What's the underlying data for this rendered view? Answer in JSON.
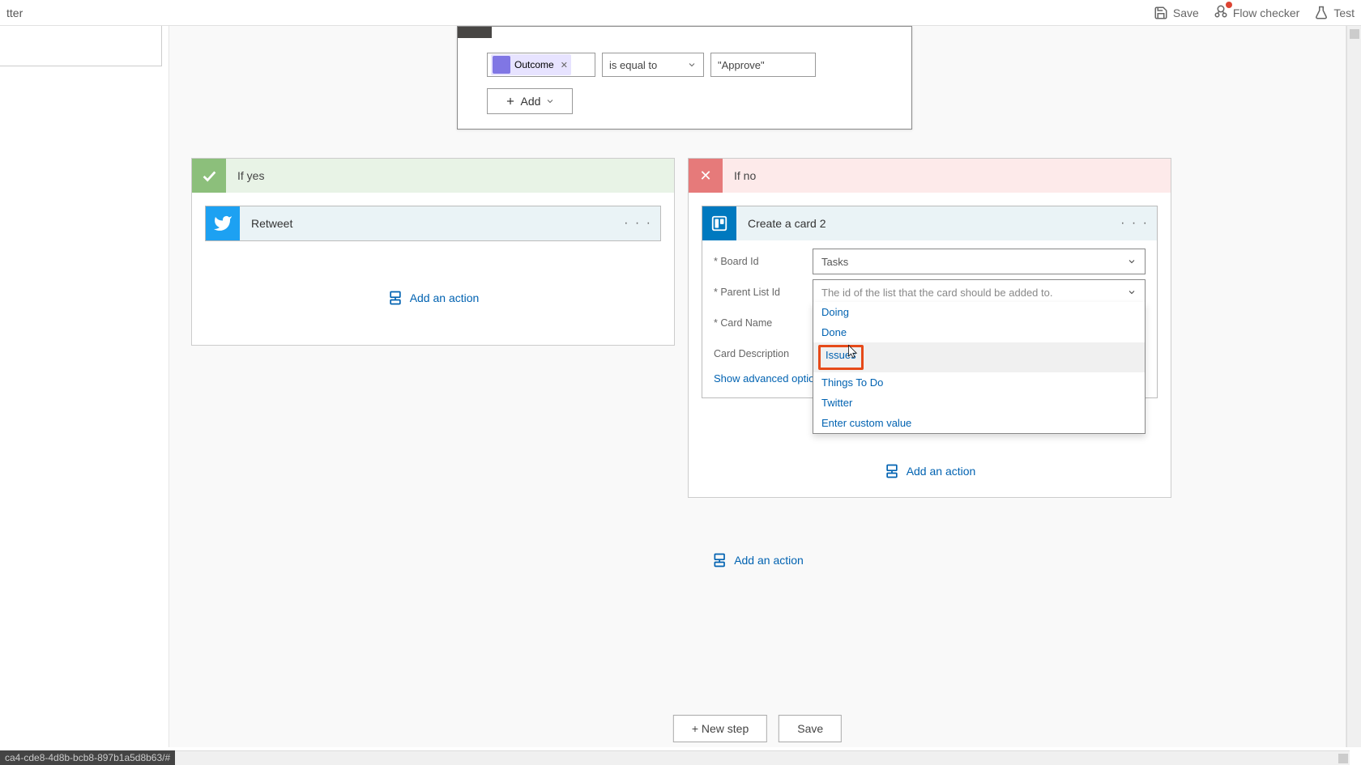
{
  "topbar": {
    "title_fragment": "tter",
    "save": "Save",
    "flow_checker": "Flow checker",
    "test": "Test"
  },
  "condition": {
    "token_label": "Outcome",
    "operator": "is equal to",
    "value": "\"Approve\"",
    "add_label": "Add"
  },
  "branches": {
    "yes_label": "If yes",
    "no_label": "If no"
  },
  "retweet": {
    "title": "Retweet"
  },
  "add_action_label": "Add an action",
  "trello": {
    "title": "Create a card 2",
    "fields": {
      "board_id": {
        "label": "* Board Id",
        "value": "Tasks"
      },
      "parent_list_id": {
        "label": "* Parent List Id",
        "placeholder": "The id of the list that the card should be added to."
      },
      "card_name": {
        "label": "* Card Name"
      },
      "card_description": {
        "label": "Card Description"
      }
    },
    "show_advanced": "Show advanced options",
    "dropdown": {
      "options": [
        "Doing",
        "Done",
        "Issues",
        "Things To Do",
        "Twitter"
      ],
      "custom": "Enter custom value",
      "highlighted_index": 2
    }
  },
  "bottom": {
    "new_step": "+ New step",
    "save": "Save"
  },
  "statusbar": "ca4-cde8-4d8b-bcb8-897b1a5d8b63/#"
}
